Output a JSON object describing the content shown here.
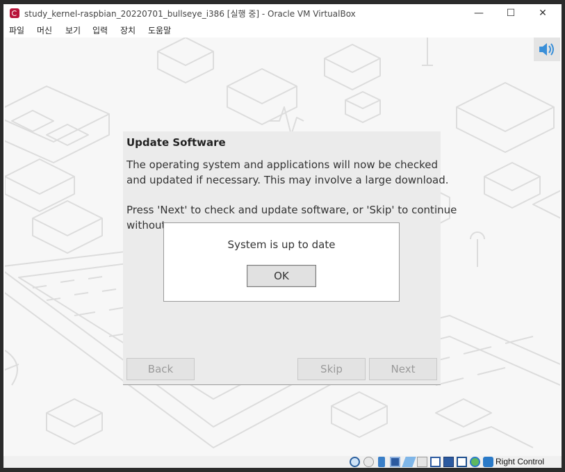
{
  "window": {
    "title": "study_kernel-raspbian_20220701_bullseye_i386 [실행 중] - Oracle VM VirtualBox",
    "controls": {
      "minimize": "—",
      "maximize": "☐",
      "close": "✕"
    }
  },
  "menubar": {
    "items": [
      {
        "label": "파일"
      },
      {
        "label": "머신"
      },
      {
        "label": "보기"
      },
      {
        "label": "입력"
      },
      {
        "label": "장치"
      },
      {
        "label": "도움말"
      }
    ]
  },
  "dialog": {
    "title": "Update Software",
    "line1": "The operating system and applications will now be checked",
    "line2": "and updated if necessary. This may involve a large download.",
    "line3": "Press 'Next' to check and update software, or 'Skip' to continue",
    "line4": "without",
    "back_label": "Back",
    "skip_label": "Skip",
    "next_label": "Next"
  },
  "message_box": {
    "text": "System is up to date",
    "ok_label": "OK"
  },
  "statusbar": {
    "host_key_label": "Right Control",
    "icons": [
      "hard-disk-icon",
      "optical-drive-icon",
      "audio-icon",
      "network-icon",
      "usb-icon",
      "shared-folders-icon",
      "display-icon",
      "video-capture-icon",
      "virtualization-icon",
      "mouse-integration-icon",
      "keyboard-icon"
    ]
  },
  "colors": {
    "accent_red": "#b8143a",
    "dialog_bg": "#ebebeb",
    "disabled_text": "#9a9a9a"
  }
}
